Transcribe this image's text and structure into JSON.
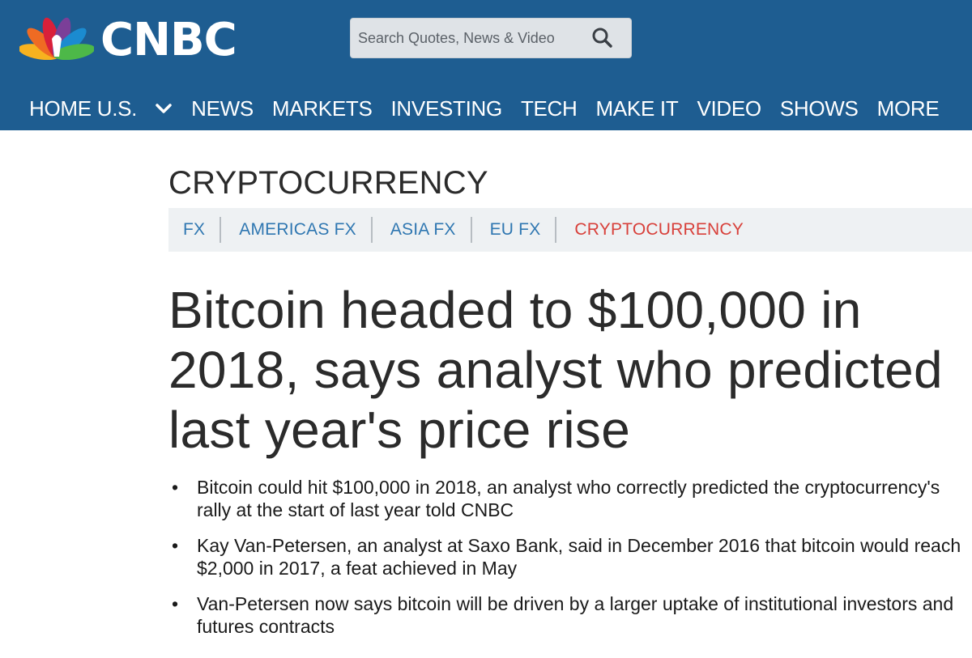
{
  "header": {
    "logo_text": "CNBC",
    "logo_icon": "nbc-peacock-icon",
    "search_placeholder": "Search Quotes, News & Video",
    "search_icon": "magnifier-icon",
    "background_color": "#1e5d91"
  },
  "nav": {
    "items": [
      {
        "label": "HOME U.S.",
        "icon": "chevron-down-icon"
      },
      {
        "label": "NEWS"
      },
      {
        "label": "MARKETS"
      },
      {
        "label": "INVESTING"
      },
      {
        "label": "TECH"
      },
      {
        "label": "MAKE IT"
      },
      {
        "label": "VIDEO"
      },
      {
        "label": "SHOWS"
      },
      {
        "label": "MORE"
      }
    ]
  },
  "section": {
    "title": "CRYPTOCURRENCY"
  },
  "subnav": {
    "items": [
      {
        "label": "FX"
      },
      {
        "label": "AMERICAS FX"
      },
      {
        "label": "ASIA FX"
      },
      {
        "label": "EU FX"
      },
      {
        "label": "CRYPTOCURRENCY",
        "active": true
      }
    ],
    "link_color": "#2f77b1",
    "active_color": "#d8403a"
  },
  "article": {
    "headline": "Bitcoin headed to $100,000 in 2018, says analyst who predicted last year's price rise",
    "key_points": [
      "Bitcoin could hit $100,000 in 2018, an analyst who correctly predicted the cryptocurrency's rally at the start of last year told CNBC",
      "Kay Van-Petersen, an analyst at Saxo Bank, said in December 2016 that bitcoin would reach $2,000 in 2017, a feat achieved in May",
      "Van-Petersen now says bitcoin will be driven by a larger uptake of institutional investors and futures contracts"
    ]
  }
}
